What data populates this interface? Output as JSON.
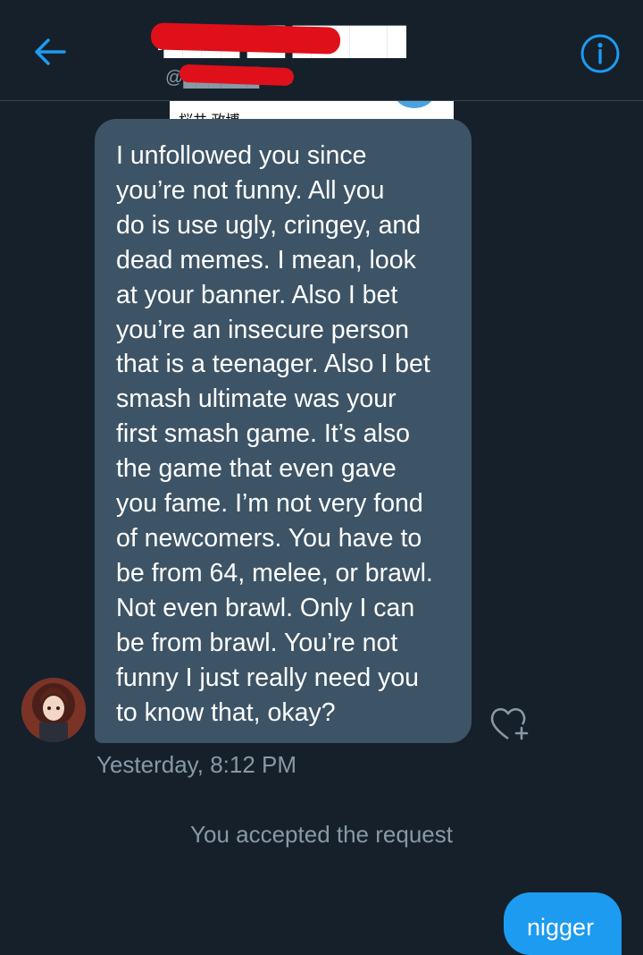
{
  "header": {
    "title": "I████ ██ ██████",
    "handle": "@██████com",
    "back_icon": "arrow-left-icon",
    "info_icon": "info-icon",
    "accent_color": "#1d9bf0"
  },
  "conversation": {
    "quoted_card_text": "桜井 政博",
    "received_message": {
      "lines": [
        "I unfollowed you since",
        "you’re not funny. All you",
        "do is use ugly, cringey, and",
        "dead memes. I mean, look",
        "at your banner. Also I bet",
        "you’re an insecure person",
        "that is a teenager. Also I bet",
        "smash ultimate was your",
        "first smash game. It’s also",
        "the game that even gave",
        "you fame. I’m not very fond",
        "of newcomers. You have to",
        "be from 64, melee, or brawl.",
        "Not even brawl. Only I can",
        "be from brawl. You’re not",
        "funny I just really need you",
        "to know that, okay?"
      ],
      "timestamp": "Yesterday, 8:12 PM"
    },
    "system_message": "You accepted the request",
    "sent_message_text": "nigger"
  }
}
